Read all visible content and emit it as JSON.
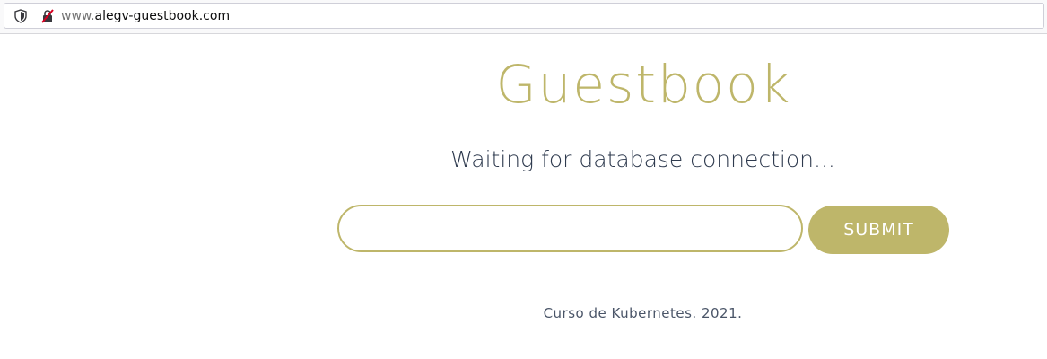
{
  "browser": {
    "url_prefix": "www.",
    "url_host": "alegv-guestbook.com",
    "shield_icon": "tracking-protection-shield-icon",
    "security_icon": "insecure-connection-icon"
  },
  "page": {
    "title": "Guestbook",
    "status": "Waiting for database connection...",
    "entry_placeholder": "",
    "entry_value": "",
    "submit_label": "SUBMIT",
    "footer": "Curso de Kubernetes. 2021."
  },
  "colors": {
    "accent": "#beb66a",
    "status_text": "#2e3a4e",
    "footer_text": "#4a5568",
    "button_text": "#ffffff"
  }
}
